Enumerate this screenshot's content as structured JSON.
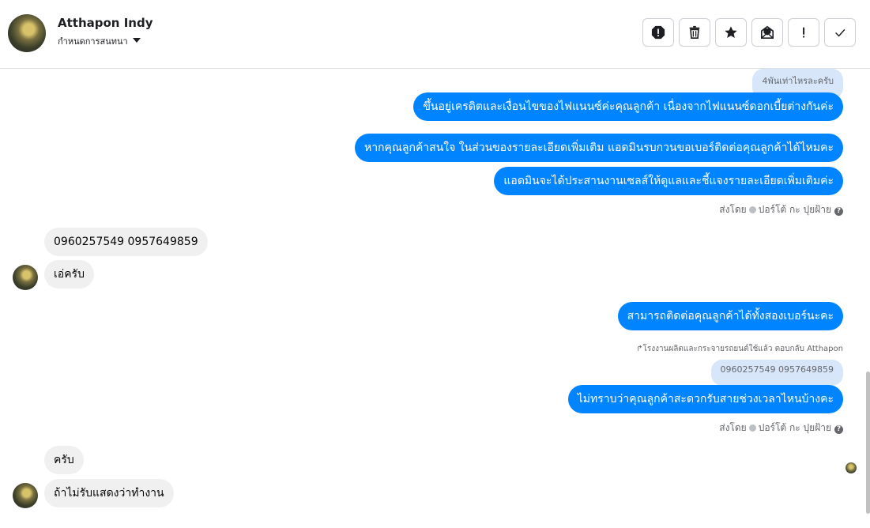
{
  "header": {
    "name": "Atthapon Indy",
    "assign_label": "กำหนดการสนทนา",
    "actions": [
      {
        "icon": "exclamation-circle-icon"
      },
      {
        "icon": "trash-icon"
      },
      {
        "icon": "star-icon"
      },
      {
        "icon": "mark-unread-icon"
      },
      {
        "icon": "exclamation-icon"
      },
      {
        "icon": "check-icon"
      }
    ]
  },
  "messages": {
    "quote1": "4พันเท่าไหรละครับ",
    "out1": "ขึ้นอยู่เครดิตและเงื่อนไขของไฟแนนซ์ค่ะคุณลูกค้า เนื่องจากไฟแนนซ์ดอกเบี้ยต่างกันค่ะ",
    "out2": "หากคุณลูกค้าสนใจ ในส่วนของรายละเอียดเพิ่มเติม แอดมินรบกวนขอเบอร์ติดต่อคุณลูกค้าได้ไหมคะ",
    "out3": "แอดมินจะได้ประสานงานเซลส์ให้ดูแลและชี้แจงรายละเอียดเพิ่มเติมค่ะ",
    "sent_by_1": {
      "prefix": "ส่งโดย",
      "agent": "ปอร์โต้ กะ ปุยฝ้าย"
    },
    "in1": "0960257549 0957649859",
    "in2": "เอ่ครับ",
    "out4": "สามารถติดต่อคุณลูกค้าได้ทั้งสองเบอร์นะคะ",
    "reply_label": "โรงงานผลิตและกระจายรถยนต์ใช้แล้ว ตอบกลับ Atthapon",
    "quote2": "0960257549 0957649859",
    "out5": "ไม่ทราบว่าคุณลูกค้าสะดวกรับสายช่วงเวลาไหนบ้างคะ",
    "sent_by_2": {
      "prefix": "ส่งโดย",
      "agent": "ปอร์โต้ กะ ปุยฝ้าย"
    },
    "in3": "ครับ",
    "in4": "ถ้าไม่รับแสดงว่าทำงาน"
  },
  "colors": {
    "outgoing_bubble": "#0084ff",
    "incoming_bubble": "#f0f0f0",
    "quoted_bubble": "#d8e6fa"
  }
}
